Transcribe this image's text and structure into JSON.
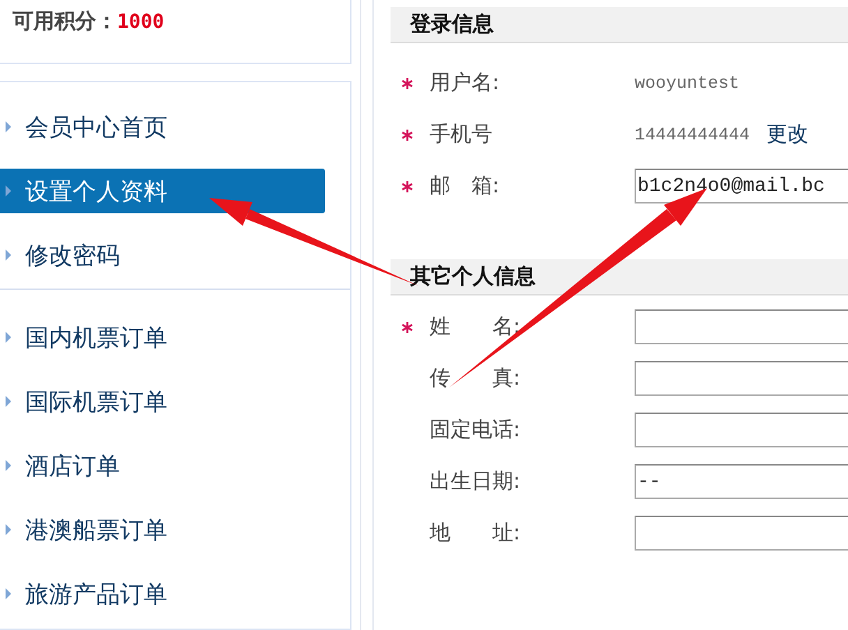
{
  "points": {
    "label": "可用积分：",
    "value": "1000"
  },
  "sidebar": {
    "groups": [
      {
        "items": [
          {
            "label": "会员中心首页",
            "selected": false
          },
          {
            "label": "设置个人资料",
            "selected": true
          },
          {
            "label": "修改密码",
            "selected": false
          }
        ]
      },
      {
        "items": [
          {
            "label": "国内机票订单",
            "selected": false
          },
          {
            "label": "国际机票订单",
            "selected": false
          },
          {
            "label": "酒店订单",
            "selected": false
          },
          {
            "label": "港澳船票订单",
            "selected": false
          },
          {
            "label": "旅游产品订单",
            "selected": false
          }
        ]
      }
    ]
  },
  "sections": [
    {
      "title": "登录信息",
      "fields": [
        {
          "label": "用户名:",
          "required": true,
          "kind": "text",
          "value": "wooyuntest"
        },
        {
          "label": "手机号",
          "required": true,
          "kind": "text",
          "value": "14444444444",
          "link": "更改"
        },
        {
          "label": "邮　箱:",
          "required": true,
          "kind": "input",
          "value": "b1c2n4o0@mail.bc"
        }
      ]
    },
    {
      "title": "其它个人信息",
      "fields": [
        {
          "label": "姓　　名:",
          "required": true,
          "kind": "input"
        },
        {
          "label": "传　　真:",
          "required": false,
          "kind": "input"
        },
        {
          "label": "固定电话:",
          "required": false,
          "kind": "input"
        },
        {
          "label": "出生日期:",
          "required": false,
          "kind": "input",
          "value": "--"
        },
        {
          "label": "地　　址:",
          "required": false,
          "kind": "input"
        }
      ]
    }
  ]
}
